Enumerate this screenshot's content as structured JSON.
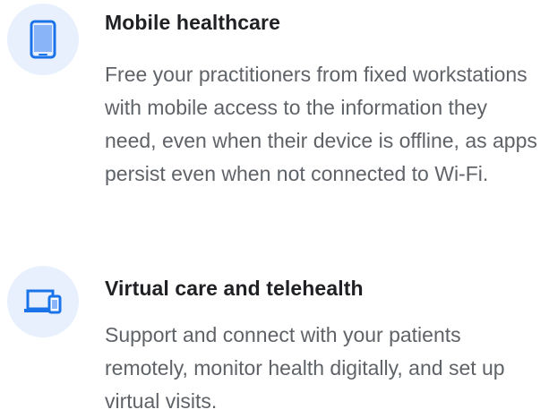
{
  "features": [
    {
      "icon": "smartphone-icon",
      "title": "Mobile healthcare",
      "description": "Free your practitioners from fixed workstations with mobile access to the information they need, even when their device is offline, as apps persist even when not connected to Wi-Fi."
    },
    {
      "icon": "devices-icon",
      "title": "Virtual care and telehealth",
      "description": "Support and connect with your patients remotely, monitor health digitally, and set up virtual visits."
    }
  ],
  "colors": {
    "icon_background": "#e8f0fe",
    "icon_accent": "#1a73e8",
    "title_text": "#202124",
    "body_text": "#5f6368"
  }
}
